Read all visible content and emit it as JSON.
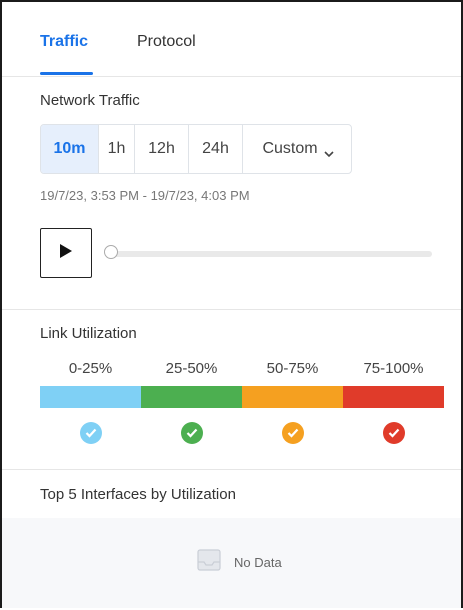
{
  "tabs": [
    {
      "label": "Traffic",
      "active": true
    },
    {
      "label": "Protocol",
      "active": false
    }
  ],
  "network_traffic": {
    "title": "Network Traffic",
    "ranges": [
      "10m",
      "1h",
      "12h",
      "24h",
      "Custom"
    ],
    "selected_range": "10m",
    "date_range": "19/7/23, 3:53 PM - 19/7/23, 4:03 PM",
    "slider_position": 0
  },
  "link_utilization": {
    "title": "Link Utilization",
    "levels": [
      {
        "label": "0-25%",
        "color": "#7fd0f5"
      },
      {
        "label": "25-50%",
        "color": "#4caf50"
      },
      {
        "label": "50-75%",
        "color": "#f5a020"
      },
      {
        "label": "75-100%",
        "color": "#e03b2a"
      }
    ]
  },
  "top_interfaces": {
    "title": "Top 5 Interfaces by Utilization",
    "empty_text": "No Data"
  },
  "colors": {
    "accent": "#1a73e8",
    "selected_bg": "#e6effc"
  },
  "icons": {
    "play": "play-icon",
    "dropdown": "chevron-down-icon",
    "check": "check-circle-icon",
    "nodata": "empty-inbox-icon"
  }
}
